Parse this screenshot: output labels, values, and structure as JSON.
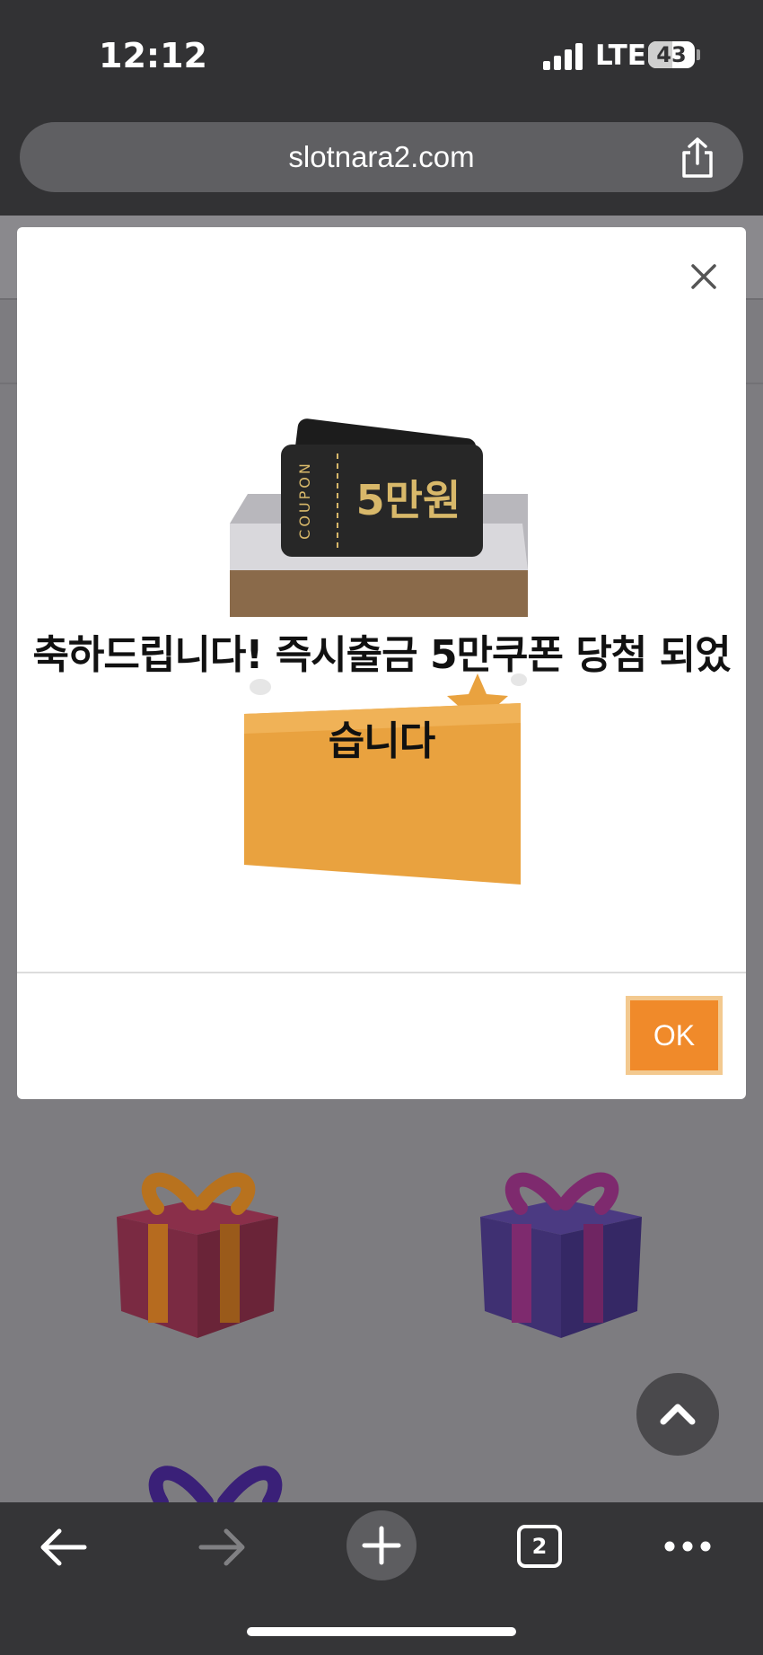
{
  "status": {
    "time": "12:12",
    "network": "LTE",
    "battery": "43"
  },
  "browser": {
    "url": "slotnara2.com",
    "tab_count": "2"
  },
  "modal": {
    "coupon_label": "COUPON",
    "coupon_amount": "5만원",
    "message": "축하드립니다! 즉시출금 5만쿠폰 당첨 되었습니다",
    "ok_label": "OK"
  },
  "colors": {
    "accent": "#f08a2a",
    "overlay": "#7d7c80",
    "box": "#e9a23f"
  }
}
